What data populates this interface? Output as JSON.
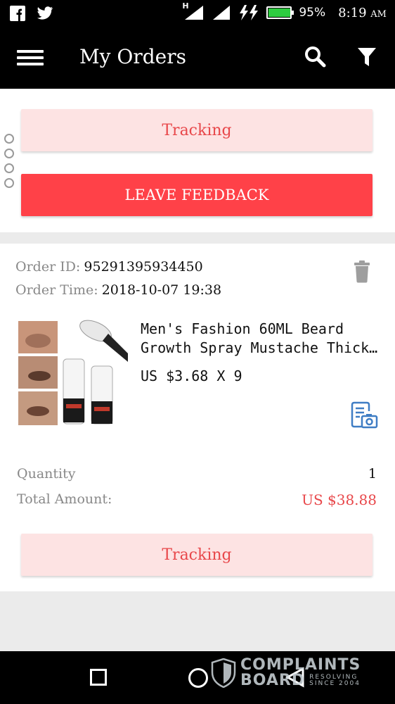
{
  "status_bar": {
    "battery": "95%",
    "time": "8:19",
    "ampm": "AM",
    "network_badge": "H"
  },
  "app_bar": {
    "title": "My Orders"
  },
  "card1": {
    "tracking_label": "Tracking",
    "feedback_label": "LEAVE FEEDBACK"
  },
  "order": {
    "id_label": "Order ID:",
    "id_value": "95291395934450",
    "time_label": "Order Time:",
    "time_value": "2018-10-07 19:38",
    "product_name_line1": "Men's Fashion 60ML Beard",
    "product_name_line2": "Growth Spray Mustache Thicker...",
    "price": "US $3.68 X 9",
    "quantity_label": "Quantity",
    "quantity_value": "1",
    "total_label": "Total Amount:",
    "total_value": "US $38.88",
    "tracking_label": "Tracking"
  },
  "watermark": {
    "line1": "COMPLAINTS",
    "line2": "BOARD",
    "tag1": "RESOLVING",
    "tag2": "SINCE 2004"
  },
  "colors": {
    "accent": "#ff4148",
    "tracking_bg": "#fde3e3",
    "price_red": "#e8474a"
  }
}
